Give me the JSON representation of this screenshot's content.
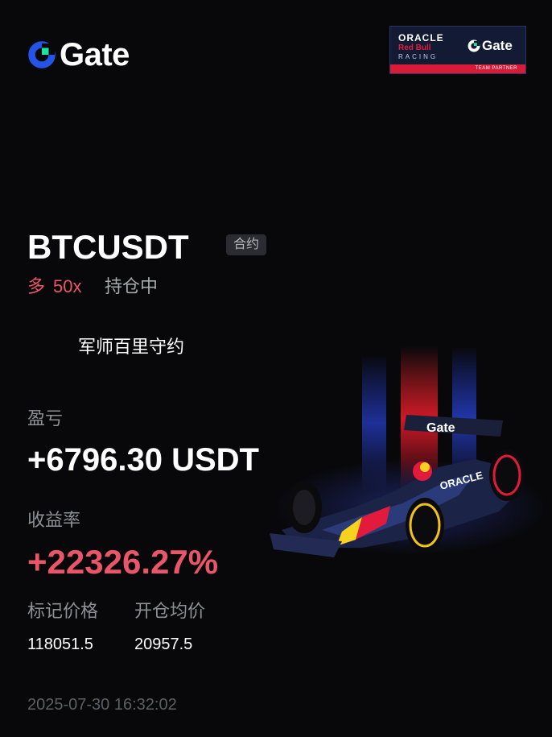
{
  "brand": {
    "name": "Gate"
  },
  "partner": {
    "oracle": "ORACLE",
    "redbull": "Red Bull",
    "racing": "RACING",
    "gate": "Gate",
    "caption": "TEAM PARTNER"
  },
  "position": {
    "symbol": "BTCUSDT",
    "type_tag": "合约",
    "side": "多",
    "leverage": "50x",
    "status": "持仓中"
  },
  "user": {
    "nickname": "军师百里守约"
  },
  "pnl": {
    "label": "盈亏",
    "value": "+6796.30 USDT"
  },
  "roi": {
    "label": "收益率",
    "value": "+22326.27%"
  },
  "prices": {
    "mark_label": "标记价格",
    "mark_value": "118051.5",
    "entry_label": "开仓均价",
    "entry_value": "20957.5"
  },
  "timestamp": "2025-07-30 16:32:02",
  "colors": {
    "background": "#08080a",
    "profit_red": "#e9566a",
    "brand_blue": "#2354e6",
    "brand_green": "#17e6a1"
  }
}
